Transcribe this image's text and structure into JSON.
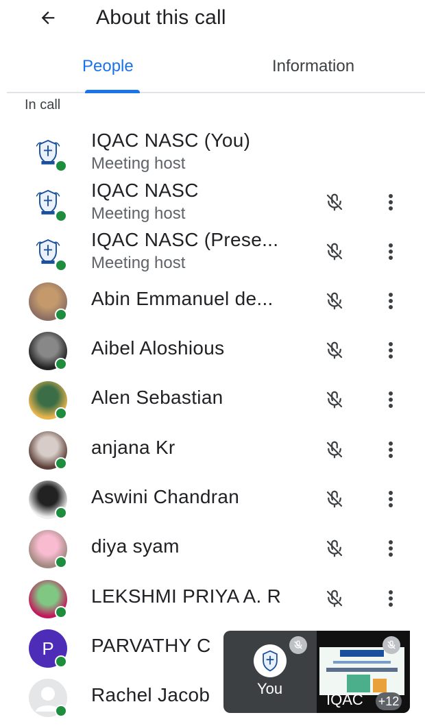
{
  "header": {
    "title": "About this call",
    "back_icon": "arrow-left-icon"
  },
  "tabs": [
    {
      "label": "People",
      "active": true
    },
    {
      "label": "Information",
      "active": false
    }
  ],
  "section_label": "In call",
  "participants": [
    {
      "name": "IQAC NASC (You)",
      "subtitle": "Meeting host",
      "avatar": "college-logo",
      "online": true,
      "muted": false,
      "menu": false
    },
    {
      "name": "IQAC NASC",
      "subtitle": "Meeting host",
      "avatar": "college-logo",
      "online": true,
      "muted": true,
      "menu": true
    },
    {
      "name": "IQAC NASC (Prese...",
      "subtitle": "Meeting host",
      "avatar": "college-logo",
      "online": true,
      "muted": true,
      "menu": true
    },
    {
      "name": "Abin Emmanuel de...",
      "avatar": "photo",
      "online": true,
      "muted": true,
      "menu": true
    },
    {
      "name": "Aibel Aloshious",
      "avatar": "photo",
      "online": true,
      "muted": true,
      "menu": true
    },
    {
      "name": "Alen Sebastian",
      "avatar": "photo",
      "online": true,
      "muted": true,
      "menu": true
    },
    {
      "name": "anjana Kr",
      "avatar": "photo",
      "online": true,
      "muted": true,
      "menu": true
    },
    {
      "name": "Aswini Chandran",
      "avatar": "photo",
      "online": true,
      "muted": true,
      "menu": true
    },
    {
      "name": "diya syam",
      "avatar": "photo",
      "online": true,
      "muted": true,
      "menu": true
    },
    {
      "name": "LEKSHMI PRIYA A. R",
      "avatar": "photo",
      "online": true,
      "muted": true,
      "menu": true
    },
    {
      "name": "PARVATHY C",
      "avatar": "letter",
      "avatar_letter": "P",
      "online": true
    },
    {
      "name": "Rachel Jacob",
      "avatar": "blank",
      "online": true
    }
  ],
  "pip": {
    "self_label": "You",
    "presenter_label": "IQAC",
    "extra_count": "+12"
  },
  "colors": {
    "accent": "#1a73e8",
    "online": "#1e8e3e",
    "letter_avatar": "#4d2db7"
  }
}
